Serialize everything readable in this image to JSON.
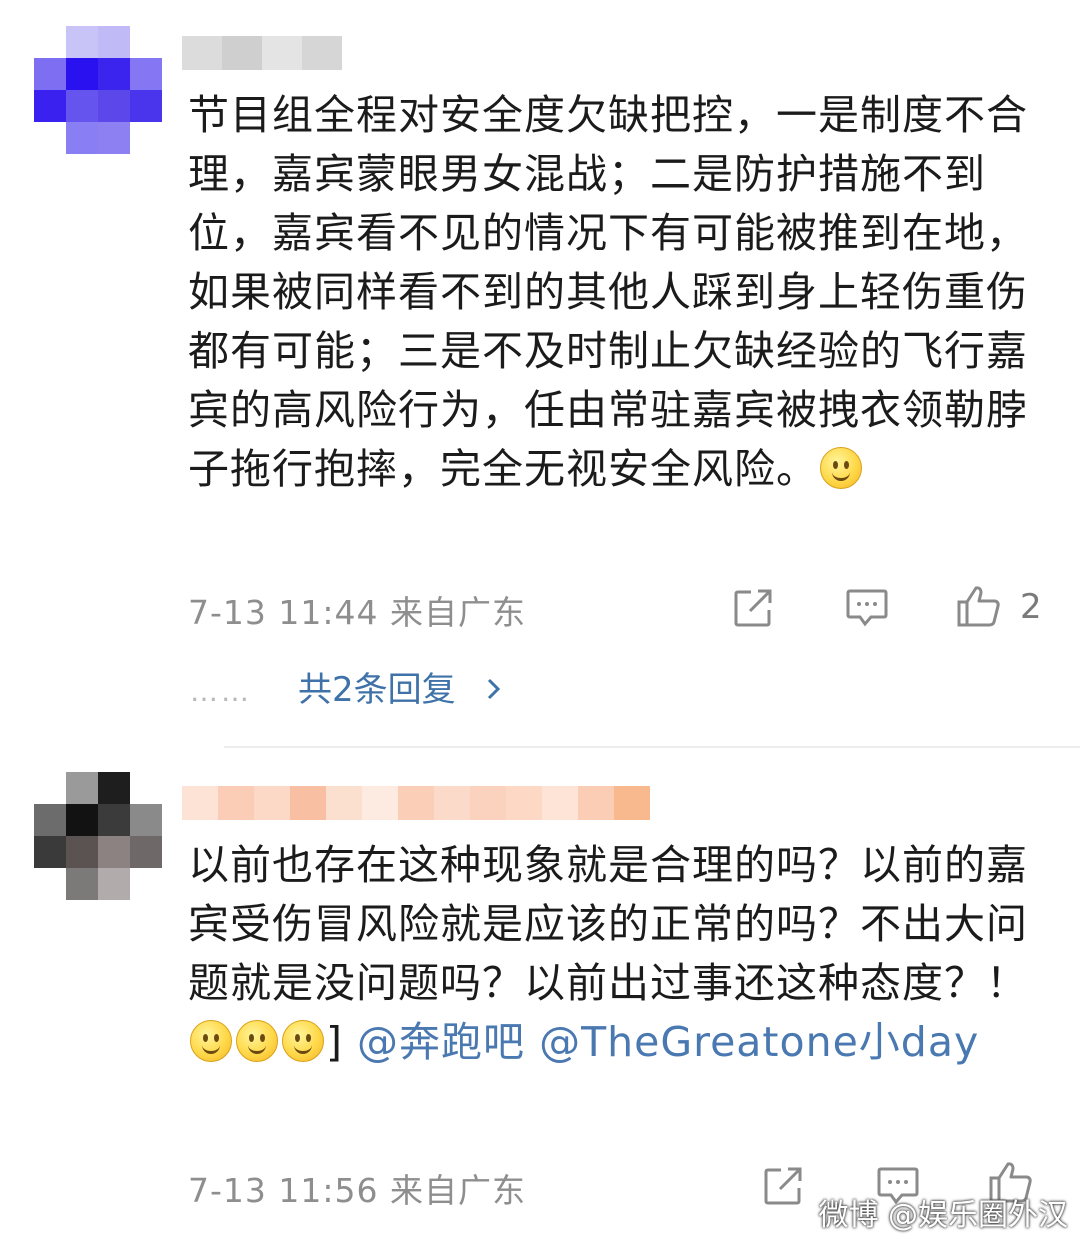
{
  "comments": [
    {
      "text": "节目组全程对安全度欠缺把控，一是制度不合理，嘉宾蒙眼男女混战；二是防护措施不到位，嘉宾看不见的情况下有可能被推到在地，如果被同样看不到的其他人踩到身上轻伤重伤都有可能；三是不及时制止欠缺经验的飞行嘉宾的高风险行为，任由常驻嘉宾被拽衣领勒脖子拖行抱摔，完全无视安全风险。",
      "emoji_count": 1,
      "meta": "7-13 11:44 来自广东",
      "like_count": "2",
      "replies_label": "共2条回复",
      "replies_dots": "……"
    },
    {
      "text": "以前也存在这种现象就是合理的吗？以前的嘉宾受伤冒风险就是应该的正常的吗？不出大问题就是没问题吗？以前出过事还这种态度？！",
      "emoji_count": 3,
      "after_emoji": "]",
      "mention_1": "@奔跑吧",
      "mention_2": "@TheGreatone小day",
      "meta": "7-13 11:56 来自广东"
    }
  ],
  "watermark": "微博 @娱乐圈外汉",
  "colors": {
    "link": "#3f72a8",
    "meta": "#8e8e8e",
    "icon": "#8a8a8a"
  },
  "icons": [
    "share-icon",
    "comment-icon",
    "like-icon",
    "chevron-right-icon",
    "smile-emoji"
  ]
}
